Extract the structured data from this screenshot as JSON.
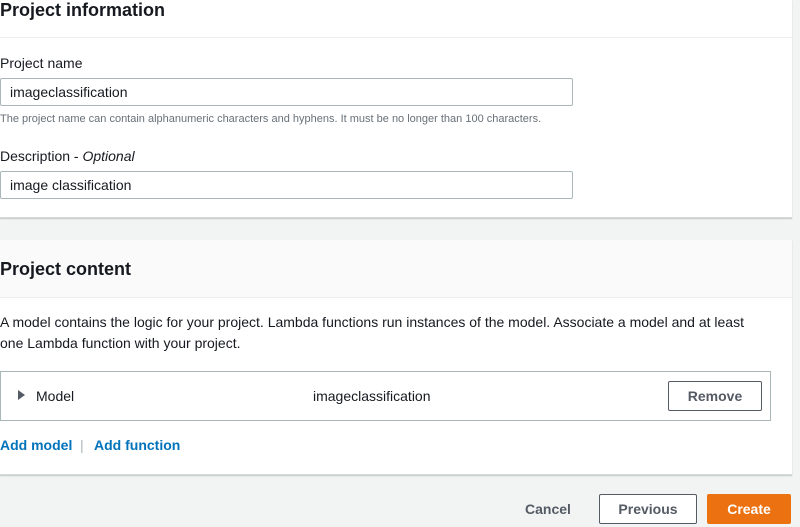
{
  "project_information": {
    "title": "Project information",
    "name_label": "Project name",
    "name_value": "imageclassification",
    "name_hint": "The project name can contain alphanumeric characters and hyphens. It must be no longer than 100 characters.",
    "description_label": "Description - ",
    "description_optional": "Optional",
    "description_value": "image classification"
  },
  "project_content": {
    "title": "Project content",
    "description": "A model contains the logic for your project. Lambda functions run instances of the model. Associate a model and at least one Lambda function with your project.",
    "model_row": {
      "label": "Model",
      "name": "imageclassification",
      "remove_label": "Remove"
    },
    "add_model_label": "Add model",
    "separator": "|",
    "add_function_label": "Add function"
  },
  "footer": {
    "cancel_label": "Cancel",
    "previous_label": "Previous",
    "create_label": "Create"
  },
  "colors": {
    "primary_button": "#ec7211",
    "link": "#0073bb",
    "background": "#f2f3f3"
  },
  "icons": {
    "expand": "caret-right-icon"
  }
}
